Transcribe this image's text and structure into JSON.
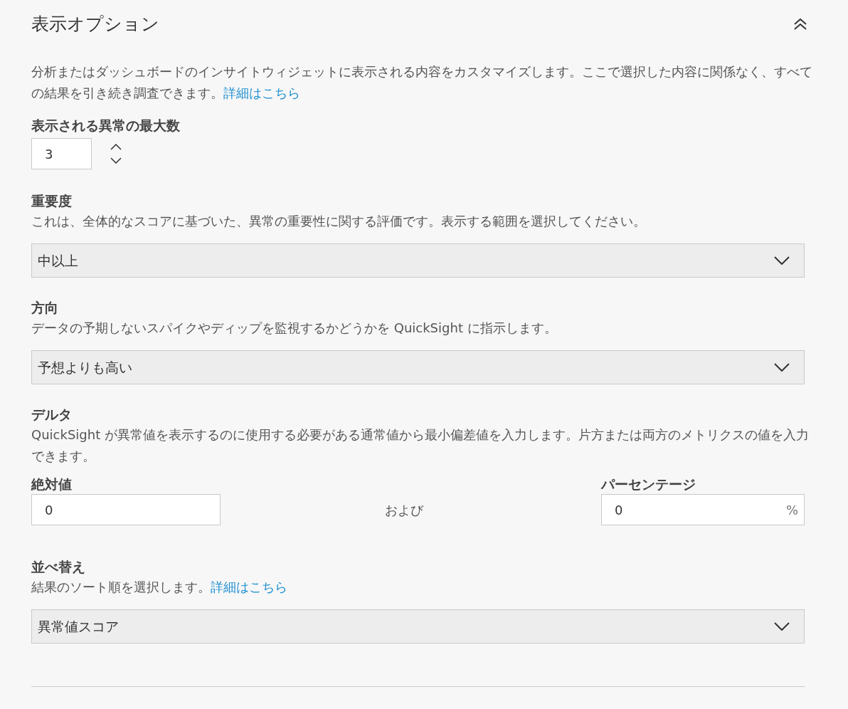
{
  "panel": {
    "title": "表示オプション",
    "expanded": true,
    "description": "分析またはダッシュボードのインサイトウィジェットに表示される内容をカスタマイズします。ここで選択した内容に関係なく、すべての結果を引き続き調査できます。",
    "description_link": "詳細はこちら"
  },
  "max_anomalies": {
    "label": "表示される異常の最大数",
    "value": "3"
  },
  "severity": {
    "label": "重要度",
    "help": "これは、全体的なスコアに基づいた、異常の重要性に関する評価です。表示する範囲を選択してください。",
    "value": "中以上"
  },
  "direction": {
    "label": "方向",
    "help": "データの予期しないスパイクやディップを監視するかどうかを QuickSight に指示します。",
    "value": "予想よりも高い"
  },
  "delta": {
    "label": "デルタ",
    "help": "QuickSight が異常値を表示するのに使用する必要がある通常値から最小偏差値を入力します。片方または両方のメトリクスの値を入力できます。",
    "absolute": {
      "label": "絶対値",
      "value": "0"
    },
    "conjunction": "および",
    "percentage": {
      "label": "パーセンテージ",
      "value": "0",
      "suffix": "%"
    }
  },
  "sort": {
    "label": "並べ替え",
    "help": "結果のソート順を選択します。",
    "help_link": "詳細はこちら",
    "value": "異常値スコア"
  }
}
